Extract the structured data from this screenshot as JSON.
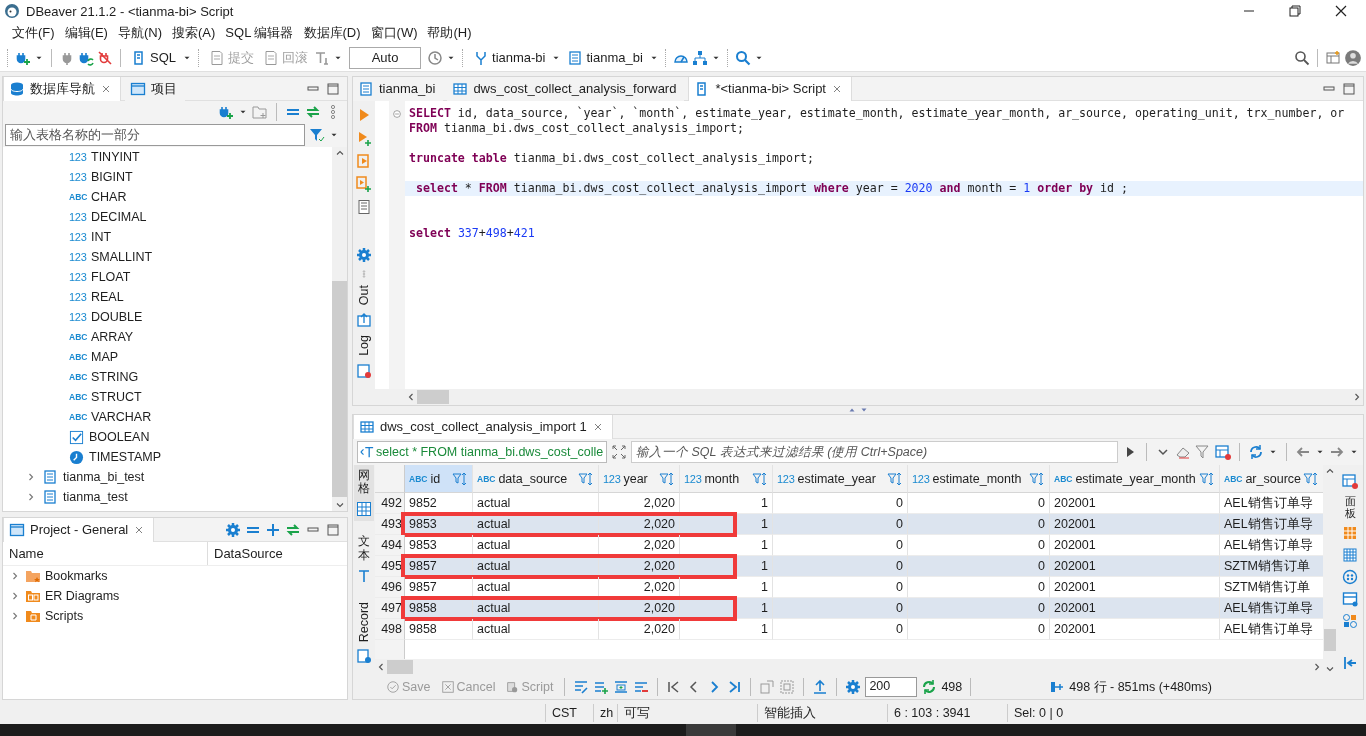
{
  "window": {
    "title": "DBeaver 21.1.2 - <tianma-bi> Script"
  },
  "menu": [
    "文件(F)",
    "编辑(E)",
    "导航(N)",
    "搜索(A)",
    "SQL 编辑器",
    "数据库(D)",
    "窗口(W)",
    "帮助(H)"
  ],
  "toolbar": {
    "sql_button": "SQL",
    "commit": {
      "label": "提交",
      "disabled": true
    },
    "rollback": {
      "label": "回滚",
      "disabled": true
    },
    "transaction_mode": "Auto",
    "datasource": "tianma-bi",
    "schema": "tianma_bi"
  },
  "navigator": {
    "tabs": [
      {
        "label": "数据库导航",
        "selected": true
      },
      {
        "label": "项目",
        "selected": false
      }
    ],
    "filter_placeholder": "输入表格名称的一部分",
    "types": [
      {
        "kind": "number",
        "badge": "123",
        "name": "TINYINT"
      },
      {
        "kind": "number",
        "badge": "123",
        "name": "BIGINT"
      },
      {
        "kind": "text",
        "badge": "ABC",
        "name": "CHAR"
      },
      {
        "kind": "number",
        "badge": "123",
        "name": "DECIMAL"
      },
      {
        "kind": "number",
        "badge": "123",
        "name": "INT"
      },
      {
        "kind": "number",
        "badge": "123",
        "name": "SMALLINT"
      },
      {
        "kind": "number",
        "badge": "123",
        "name": "FLOAT"
      },
      {
        "kind": "number",
        "badge": "123",
        "name": "REAL"
      },
      {
        "kind": "number",
        "badge": "123",
        "name": "DOUBLE"
      },
      {
        "kind": "text",
        "badge": "ABC",
        "name": "ARRAY"
      },
      {
        "kind": "text",
        "badge": "ABC",
        "name": "MAP"
      },
      {
        "kind": "text",
        "badge": "ABC",
        "name": "STRING"
      },
      {
        "kind": "text",
        "badge": "ABC",
        "name": "STRUCT"
      },
      {
        "kind": "text",
        "badge": "ABC",
        "name": "VARCHAR"
      },
      {
        "kind": "boolean",
        "name": "BOOLEAN"
      },
      {
        "kind": "time",
        "name": "TIMESTAMP"
      }
    ],
    "databases": [
      {
        "name": "tianma_bi_test",
        "expanded": false
      },
      {
        "name": "tianma_test",
        "expanded": false
      }
    ]
  },
  "project": {
    "title": "Project - General",
    "columns": [
      "Name",
      "DataSource"
    ],
    "items": [
      {
        "kind": "bookmarks",
        "name": "Bookmarks",
        "expanded": false
      },
      {
        "kind": "diagrams",
        "name": "ER Diagrams",
        "expanded": false
      },
      {
        "kind": "scripts",
        "name": "Scripts",
        "expanded": false
      }
    ]
  },
  "editor": {
    "tabs": [
      {
        "kind": "database",
        "label": "tianma_bi",
        "selected": false
      },
      {
        "kind": "table",
        "label": "dws_cost_collect_analysis_forward",
        "selected": false
      },
      {
        "kind": "script",
        "label": "*<tianma-bi> Script",
        "selected": true
      }
    ],
    "side_tabs": [
      "Out",
      "Log"
    ],
    "lines": [
      {
        "current": false,
        "tokens": [
          {
            "keyword": "SELECT"
          },
          {
            "text": " id, data_source, `year`, `month`, estimate_year, estimate_month, estimate_year_month, ar_source, operating_unit, trx_number, or"
          }
        ]
      },
      {
        "current": false,
        "tokens": [
          {
            "keyword": "FROM"
          },
          {
            "text": " tianma_bi.dws_cost_collect_analysis_import;"
          }
        ]
      },
      {
        "current": false
      },
      {
        "current": false,
        "tokens": [
          {
            "keyword": "truncate table"
          },
          {
            "text": " tianma_bi.dws_cost_collect_analysis_import;"
          }
        ]
      },
      {
        "current": false
      },
      {
        "current": true,
        "tokens": [
          {
            "keyword": " select"
          },
          {
            "text": " * "
          },
          {
            "keyword": "FROM"
          },
          {
            "text": " tianma_bi.dws_cost_collect_analysis_import "
          },
          {
            "keyword": "where"
          },
          {
            "text": " year = "
          },
          {
            "number": "2020"
          },
          {
            "keyword": " and"
          },
          {
            "text": " month = "
          },
          {
            "number": "1"
          },
          {
            "keyword": " order by"
          },
          {
            "text": " id ;"
          }
        ]
      },
      {
        "current": false
      },
      {
        "current": false
      },
      {
        "current": false,
        "tokens": [
          {
            "keyword": "select "
          },
          {
            "number": "337"
          },
          {
            "text": "+"
          },
          {
            "number": "498"
          },
          {
            "text": "+"
          },
          {
            "number": "421"
          }
        ]
      }
    ]
  },
  "results": {
    "tab": "dws_cost_collect_analysis_import 1",
    "query": "select * FROM tianma_bi.dws_cost_colle",
    "filter_placeholder": "输入一个 SQL 表达式来过滤结果 (使用 Ctrl+Space)",
    "view_tabs": [
      {
        "kind": "grid",
        "label": "网格",
        "selected": true
      },
      {
        "kind": "text",
        "label": "文本",
        "selected": false
      },
      {
        "kind": "record",
        "label": "Record",
        "selected": false
      }
    ],
    "panel_tab": "面板",
    "columns": [
      {
        "kind": "text",
        "badge": "ABC",
        "name": "id"
      },
      {
        "kind": "text",
        "badge": "ABC",
        "name": "data_source"
      },
      {
        "kind": "number",
        "badge": "123",
        "name": "year"
      },
      {
        "kind": "number",
        "badge": "123",
        "name": "month"
      },
      {
        "kind": "number",
        "badge": "123",
        "name": "estimate_year"
      },
      {
        "kind": "number",
        "badge": "123",
        "name": "estimate_month"
      },
      {
        "kind": "text",
        "badge": "ABC",
        "name": "estimate_year_month"
      },
      {
        "kind": "text",
        "badge": "ABC",
        "name": "ar_source"
      }
    ],
    "rows": [
      {
        "number": "492",
        "selected": false,
        "marked": false,
        "cells": [
          "9852",
          "actual",
          "2,020",
          "1",
          "0",
          "0",
          "202001",
          "AEL销售订单导"
        ]
      },
      {
        "number": "493",
        "selected": true,
        "marked": true,
        "cells": [
          "9853",
          "actual",
          "2,020",
          "1",
          "0",
          "0",
          "202001",
          "AEL销售订单导"
        ]
      },
      {
        "number": "494",
        "selected": false,
        "marked": false,
        "cells": [
          "9853",
          "actual",
          "2,020",
          "1",
          "0",
          "0",
          "202001",
          "AEL销售订单导"
        ]
      },
      {
        "number": "495",
        "selected": true,
        "marked": true,
        "cells": [
          "9857",
          "actual",
          "2,020",
          "1",
          "0",
          "0",
          "202001",
          "SZTM销售订单"
        ]
      },
      {
        "number": "496",
        "selected": false,
        "marked": false,
        "cells": [
          "9857",
          "actual",
          "2,020",
          "1",
          "0",
          "0",
          "202001",
          "SZTM销售订单"
        ]
      },
      {
        "number": "497",
        "selected": true,
        "marked": true,
        "cells": [
          "9858",
          "actual",
          "2,020",
          "1",
          "0",
          "0",
          "202001",
          "AEL销售订单导"
        ]
      },
      {
        "number": "498",
        "selected": false,
        "marked": false,
        "cells": [
          "9858",
          "actual",
          "2,020",
          "1",
          "0",
          "0",
          "202001",
          "AEL销售订单导"
        ]
      }
    ],
    "actions": [
      {
        "kind": "save",
        "label": "Save",
        "disabled": true
      },
      {
        "kind": "cancel",
        "label": "Cancel",
        "disabled": true
      },
      {
        "kind": "script",
        "label": "Script",
        "disabled": true
      }
    ],
    "fetch_size": "200",
    "row_count": "498",
    "summary": "498 行 - 851ms (+480ms)"
  },
  "status_bar": [
    "CST",
    "zh",
    "可写",
    "智能插入",
    "6 : 103 : 3941",
    "Sel: 0 | 0"
  ]
}
